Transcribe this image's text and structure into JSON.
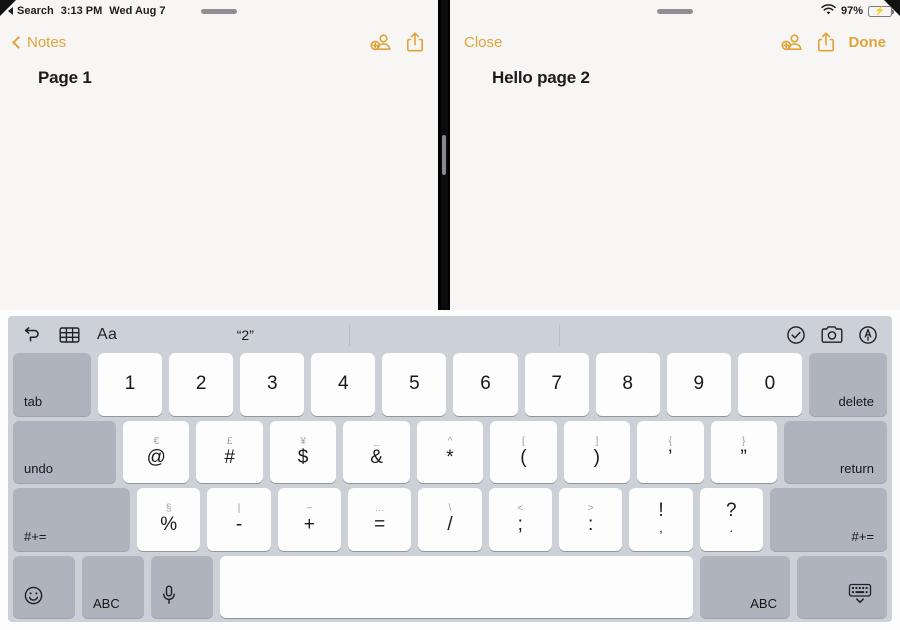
{
  "status_bar": {
    "back_app": "Search",
    "time": "3:13 PM",
    "date": "Wed Aug 7",
    "battery_percent": "97%",
    "wifi_icon": "wifi-icon",
    "battery_icon": "battery-charging-icon"
  },
  "left_pane": {
    "back_label": "Notes",
    "share_icon": "share-icon",
    "collaborate_icon": "add-person-icon",
    "note_title": "Page 1"
  },
  "right_pane": {
    "close_label": "Close",
    "done_label": "Done",
    "share_icon": "share-icon",
    "collaborate_icon": "add-person-icon",
    "note_title": "Hello page 2"
  },
  "keyboard": {
    "shortcut_bar": {
      "undo_icon": "undo-arrow-icon",
      "table_icon": "table-icon",
      "format_label": "Aa",
      "suggestions": [
        "“2”",
        "",
        "",
        ""
      ],
      "checklist_icon": "checklist-circle-icon",
      "camera_icon": "camera-icon",
      "markup_icon": "markup-pen-circle-icon"
    },
    "row1": {
      "tab_label": "tab",
      "keys": [
        "1",
        "2",
        "3",
        "4",
        "5",
        "6",
        "7",
        "8",
        "9",
        "0"
      ],
      "delete_label": "delete"
    },
    "row2": {
      "undo_label": "undo",
      "keys": [
        {
          "primary": "@",
          "secondary": "€"
        },
        {
          "primary": "#",
          "secondary": "£"
        },
        {
          "primary": "$",
          "secondary": "¥"
        },
        {
          "primary": "&",
          "secondary": "_"
        },
        {
          "primary": "*",
          "secondary": "^"
        },
        {
          "primary": "(",
          "secondary": "["
        },
        {
          "primary": ")",
          "secondary": "]"
        },
        {
          "primary": "’",
          "secondary": "{"
        },
        {
          "primary": "”",
          "secondary": "}"
        }
      ],
      "return_label": "return"
    },
    "row3": {
      "shift_left_label": "#+=",
      "keys": [
        {
          "primary": "%",
          "secondary": "§",
          "flip": false
        },
        {
          "primary": "-",
          "secondary": "|",
          "flip": false
        },
        {
          "primary": "+",
          "secondary": "~",
          "flip": false
        },
        {
          "primary": "=",
          "secondary": "…",
          "flip": false
        },
        {
          "primary": "/",
          "secondary": "\\",
          "flip": false
        },
        {
          "primary": ";",
          "secondary": "<",
          "flip": false
        },
        {
          "primary": ":",
          "secondary": ">",
          "flip": false
        },
        {
          "primary": "!",
          "secondary": ",",
          "flip": true
        },
        {
          "primary": "?",
          "secondary": ".",
          "flip": true
        }
      ],
      "shift_right_label": "#+="
    },
    "row4": {
      "emoji_icon": "emoji-smiley-icon",
      "abc_left_label": "ABC",
      "mic_icon": "microphone-icon",
      "space_label": "",
      "abc_right_label": "ABC",
      "dismiss_icon": "dismiss-keyboard-icon"
    }
  },
  "colors": {
    "accent": "#e0a33a",
    "keyboard_bg": "#ccd0d7",
    "key_light": "#fdfdfd",
    "key_dark": "#aeb3bd",
    "battery_green": "#34c759"
  }
}
